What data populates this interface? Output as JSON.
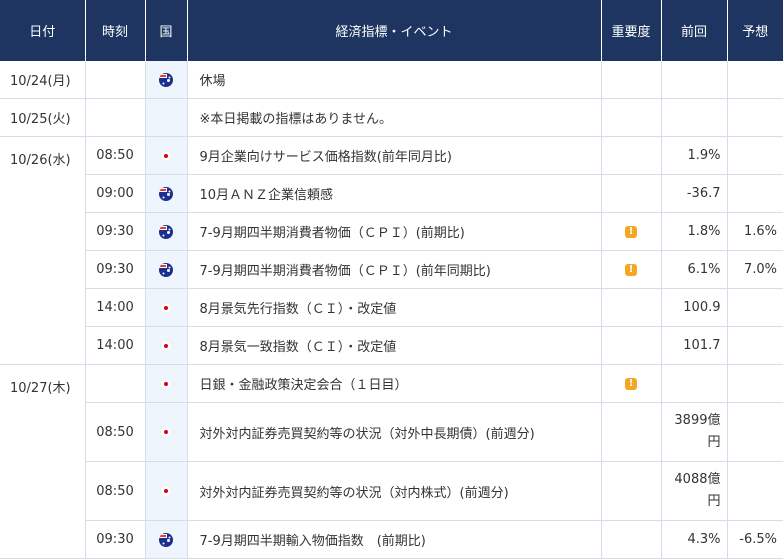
{
  "header": {
    "date": "日付",
    "time": "時刻",
    "country": "国",
    "event": "経済指標・イベント",
    "importance": "重要度",
    "previous": "前回",
    "forecast": "予想"
  },
  "colors": {
    "header_bg": "#1d3560",
    "flag_col_bg": "#eef5fc",
    "warn": "#f5a623"
  },
  "days": [
    {
      "date": "10/24(月)",
      "rows": [
        {
          "time": "",
          "country": "au-flag-icon",
          "event": "休場",
          "importance": "",
          "previous": "",
          "forecast": ""
        }
      ]
    },
    {
      "date": "10/25(火)",
      "rows": [
        {
          "time": "",
          "country": "",
          "event": "※本日掲載の指標はありません。",
          "importance": "",
          "previous": "",
          "forecast": ""
        }
      ]
    },
    {
      "date": "10/26(水)",
      "rows": [
        {
          "time": "08:50",
          "country": "jp-flag-icon",
          "event": "9月企業向けサービス価格指数(前年同月比)",
          "importance": "",
          "previous": "1.9%",
          "forecast": ""
        },
        {
          "time": "09:00",
          "country": "au-flag-icon",
          "event": "10月ＡＮＺ企業信頼感",
          "importance": "",
          "previous": "-36.7",
          "forecast": ""
        },
        {
          "time": "09:30",
          "country": "au-flag-icon",
          "event": "7-9月期四半期消費者物価（ＣＰＩ）(前期比)",
          "importance": "warning-icon",
          "previous": "1.8%",
          "forecast": "1.6%"
        },
        {
          "time": "09:30",
          "country": "au-flag-icon",
          "event": "7-9月期四半期消費者物価（ＣＰＩ）(前年同期比)",
          "importance": "warning-icon",
          "previous": "6.1%",
          "forecast": "7.0%"
        },
        {
          "time": "14:00",
          "country": "jp-flag-icon",
          "event": "8月景気先行指数（ＣＩ）・改定値",
          "importance": "",
          "previous": "100.9",
          "forecast": ""
        },
        {
          "time": "14:00",
          "country": "jp-flag-icon",
          "event": "8月景気一致指数（ＣＩ）・改定値",
          "importance": "",
          "previous": "101.7",
          "forecast": ""
        }
      ]
    },
    {
      "date": "10/27(木)",
      "rows": [
        {
          "time": "",
          "country": "jp-flag-icon",
          "event": "日銀・金融政策決定会合（１日目）",
          "importance": "warning-icon",
          "previous": "",
          "forecast": ""
        },
        {
          "time": "08:50",
          "country": "jp-flag-icon",
          "event": "対外対内証券売買契約等の状況（対外中長期債）(前週分)",
          "importance": "",
          "previous": "3899億円",
          "forecast": ""
        },
        {
          "time": "08:50",
          "country": "jp-flag-icon",
          "event": "対外対内証券売買契約等の状況（対内株式）(前週分)",
          "importance": "",
          "previous": "4088億円",
          "forecast": ""
        },
        {
          "time": "09:30",
          "country": "au-flag-icon",
          "event": "7-9月期四半期輸入物価指数　(前期比)",
          "importance": "",
          "previous": "4.3%",
          "forecast": "-6.5%"
        }
      ]
    }
  ]
}
